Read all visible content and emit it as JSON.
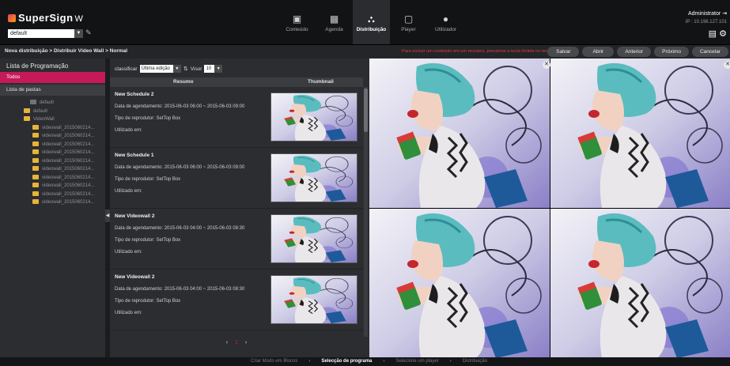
{
  "app": {
    "logo_text": "SuperSign",
    "logo_suffix": "W",
    "site_select": "default"
  },
  "nav": [
    {
      "label": "Conteúdo",
      "icon": "content-icon",
      "active": false
    },
    {
      "label": "Agenda",
      "icon": "calendar-icon",
      "active": false
    },
    {
      "label": "Distribuição",
      "icon": "distribution-icon",
      "active": true
    },
    {
      "label": "Player",
      "icon": "player-icon",
      "active": false
    },
    {
      "label": "Utilizador",
      "icon": "user-icon",
      "active": false
    }
  ],
  "user": {
    "name": "Administrator",
    "ip": "IP : 10.196.127.101"
  },
  "actionbar": {
    "breadcrumb": "Nova distribuição > Distribuir Vídeo Wall > Normal",
    "warning": "Para excluir um conteúdo em um mosaico, pressione a tecla Delete no teclado.",
    "buttons": {
      "salvar": "Salvar",
      "abrir": "Abrir",
      "anterior": "Anterior",
      "proximo": "Próximo",
      "cancelar": "Cancelar"
    }
  },
  "sidebar": {
    "title": "Lista de Programação",
    "todos": "Todos",
    "pastas": "Lista de pastas",
    "tree": [
      {
        "label": "default",
        "root": true
      },
      {
        "label": "default",
        "root": false
      },
      {
        "label": "VideoWall",
        "root": false
      },
      {
        "label": "videowall_2015060214...",
        "root": false
      },
      {
        "label": "videowall_2015060214...",
        "root": false
      },
      {
        "label": "videowall_2015060214...",
        "root": false
      },
      {
        "label": "videowall_2015060214...",
        "root": false
      },
      {
        "label": "videowall_2015060214...",
        "root": false
      },
      {
        "label": "videowall_2015060214...",
        "root": false
      },
      {
        "label": "videowall_2015060214...",
        "root": false
      },
      {
        "label": "videowall_2015060214...",
        "root": false
      },
      {
        "label": "videowall_2015060214...",
        "root": false
      },
      {
        "label": "videowall_2015060214...",
        "root": false
      }
    ]
  },
  "listpanel": {
    "sort_label": "classificar",
    "sort_value": "Última edição",
    "view_label": "Visor",
    "view_value": "10",
    "col_resumo": "Resumo",
    "col_thumb": "Thumbnail",
    "rows": [
      {
        "name": "New Schedule 2",
        "date": "Data de agendamento: 2015-06-03 06:00 ~ 2015-06-03 09:00",
        "type": "Tipo de reprodutor: SetTop Box",
        "used": "Utilizado em:"
      },
      {
        "name": "New Schedule 1",
        "date": "Data de agendamento: 2015-06-03 06:00 ~ 2015-06-03 09:00",
        "type": "Tipo de reprodutor: SetTop Box",
        "used": "Utilizado em:"
      },
      {
        "name": "New Videowall 2",
        "date": "Data de agendamento: 2015-06-03 04:00 ~ 2015-06-03 08:30",
        "type": "Tipo de reprodutor: SetTop Box",
        "used": "Utilizado em:"
      },
      {
        "name": "New Videowall 2",
        "date": "Data de agendamento: 2015-06-03 04:00 ~ 2015-06-03 08:30",
        "type": "Tipo de reprodutor: SetTop Box",
        "used": "Utilizado em:"
      }
    ],
    "pager": {
      "prev": "‹",
      "current": "1",
      "next": "›"
    }
  },
  "footer": {
    "steps": [
      "Criar Modo em Blocos",
      "Selecção de programa",
      "Selecione um player",
      "Distribuição"
    ],
    "active_step": 1
  },
  "colors": {
    "accent": "#c6195a",
    "warning": "#e03c3c"
  }
}
